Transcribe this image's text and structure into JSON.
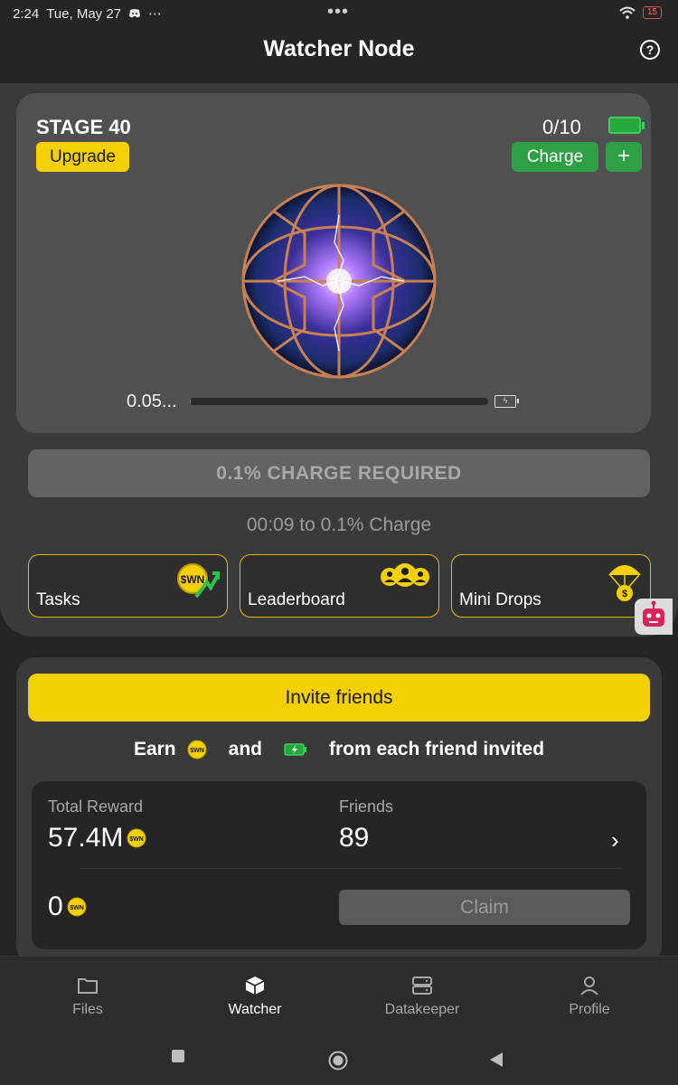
{
  "status_bar": {
    "time": "2:24",
    "date": "Tue, May 27",
    "overflow": "⋯",
    "center_dots": "•••",
    "battery_level": "15"
  },
  "header": {
    "title": "Watcher Node",
    "help_glyph": "?"
  },
  "stage": {
    "title": "STAGE 40",
    "upgrade_label": "Upgrade",
    "charge_count": "0/10",
    "charge_label": "Charge",
    "plus_label": "+",
    "progress_label": "0.05...",
    "progress_fraction": 0.0005
  },
  "charge_required_label": "0.1% CHARGE REQUIRED",
  "timer_text": "00:09  to 0.1% Charge",
  "features": [
    {
      "label": "Tasks",
      "icon": "swn-coin-arrow-icon"
    },
    {
      "label": "Leaderboard",
      "icon": "users-group-icon"
    },
    {
      "label": "Mini Drops",
      "icon": "parachute-coin-icon"
    }
  ],
  "invite": {
    "button_label": "Invite friends",
    "earn_prefix": "Earn",
    "earn_and": "and",
    "earn_suffix": "from each friend invited",
    "total_reward_label": "Total Reward",
    "total_reward_value": "57.4M",
    "friends_label": "Friends",
    "friends_value": "89",
    "claimable_value": "0",
    "claim_label": "Claim"
  },
  "coin_text": "$WN",
  "nav": [
    {
      "label": "Files",
      "icon": "folder-icon",
      "active": false
    },
    {
      "label": "Watcher",
      "icon": "cube-icon",
      "active": true
    },
    {
      "label": "Datakeeper",
      "icon": "server-icon",
      "active": false
    },
    {
      "label": "Profile",
      "icon": "person-icon",
      "active": false
    }
  ],
  "colors": {
    "accent_yellow": "#f5d000",
    "accent_green": "#2ea043",
    "background": "#252525",
    "card": "#505050"
  }
}
